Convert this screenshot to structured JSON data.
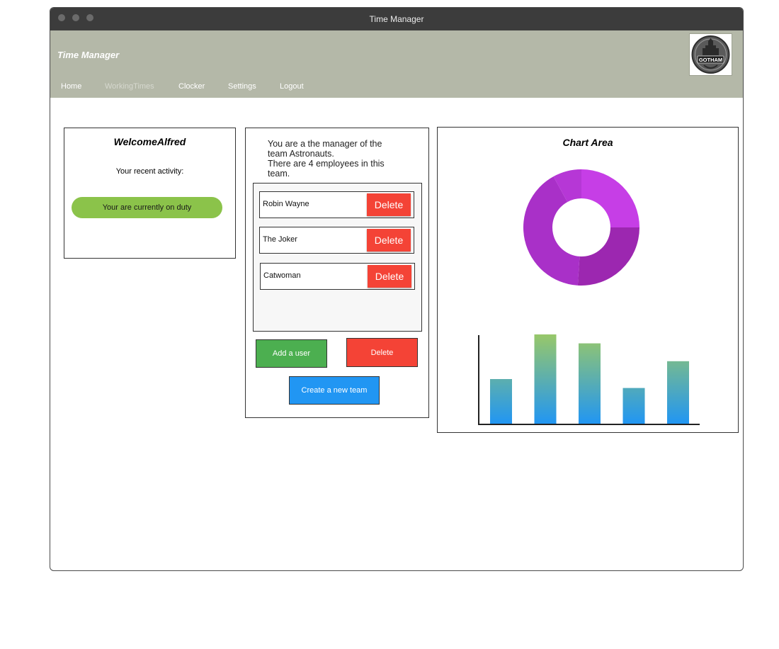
{
  "window": {
    "title": "Time Manager"
  },
  "app": {
    "title": "Time Manager",
    "logo_text": "GOTHAM"
  },
  "nav": {
    "items": [
      {
        "label": "Home",
        "state": "normal"
      },
      {
        "label": "WorkingTimes",
        "state": "disabled"
      },
      {
        "label": "Clocker",
        "state": "normal"
      },
      {
        "label": "Settings",
        "state": "normal"
      },
      {
        "label": "Logout",
        "state": "normal"
      }
    ]
  },
  "welcome": {
    "title": "WelcomeAlfred",
    "recent_label": "Your recent activity:",
    "status_text": "Your are currently on duty",
    "status_color": "#8bc34a"
  },
  "team": {
    "line1": "You are a the manager of the team Astronauts.",
    "line2": "There are 4 employees in this team.",
    "members": [
      {
        "name": "Robin Wayne",
        "action": "Delete"
      },
      {
        "name": "The Joker",
        "action": "Delete"
      },
      {
        "name": "Catwoman",
        "action": "Delete"
      }
    ],
    "add_user_label": "Add a user",
    "delete_label": "Delete",
    "create_team_label": "Create a new team",
    "colors": {
      "add": "#4caf50",
      "delete": "#f44336",
      "create": "#2196f3"
    }
  },
  "chart_area": {
    "title": "Chart Area",
    "chart_data": [
      {
        "type": "pie",
        "donut": true,
        "values": [
          25,
          26,
          41,
          8
        ],
        "colors": [
          "#c63ee6",
          "#9c27b0",
          "#a930c8",
          "#b637d6"
        ]
      },
      {
        "type": "bar",
        "values": [
          50,
          100,
          90,
          40,
          70
        ],
        "ylim": [
          0,
          100
        ],
        "gradient": [
          "#a5cd5a",
          "#2196f3"
        ]
      }
    ]
  }
}
